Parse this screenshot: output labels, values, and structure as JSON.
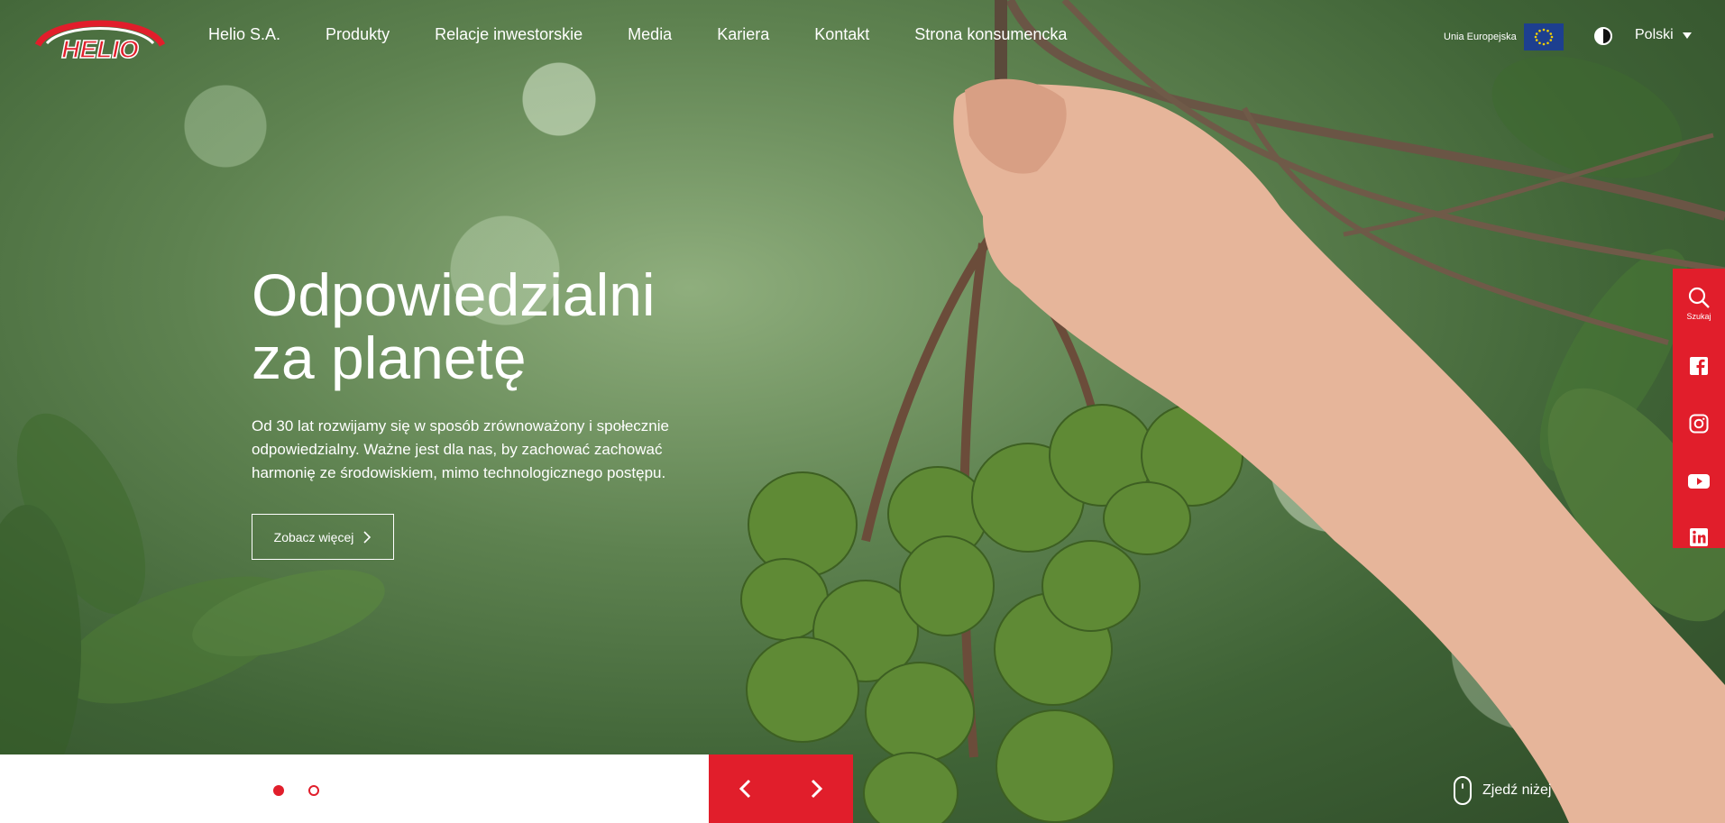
{
  "header": {
    "logo_text": "HELIO",
    "nav": [
      "Helio S.A.",
      "Produkty",
      "Relacje inwestorskie",
      "Media",
      "Kariera",
      "Kontakt",
      "Strona konsumencka"
    ],
    "eu_label": "Unia Europejska",
    "language": "Polski"
  },
  "hero": {
    "title_line1": "Odpowiedzialni",
    "title_line2": "za planetę",
    "text": "Od 30 lat rozwijamy się w sposób zrównoważony i społecznie odpowiedzialny. Ważne jest dla nas, by zachować zachować harmonię ze środowiskiem, mimo technologicznego postępu.",
    "cta_label": "Zobacz więcej"
  },
  "sidebar": {
    "search_label": "Szukaj",
    "icons": [
      "search-icon",
      "facebook-icon",
      "instagram-icon",
      "youtube-icon",
      "linkedin-icon"
    ]
  },
  "slider": {
    "slides_count": 2,
    "active_slide": 1
  },
  "scroll_label": "Zjedź niżej",
  "colors": {
    "accent": "#e11e2b",
    "eu_blue": "#1d3f8f"
  }
}
